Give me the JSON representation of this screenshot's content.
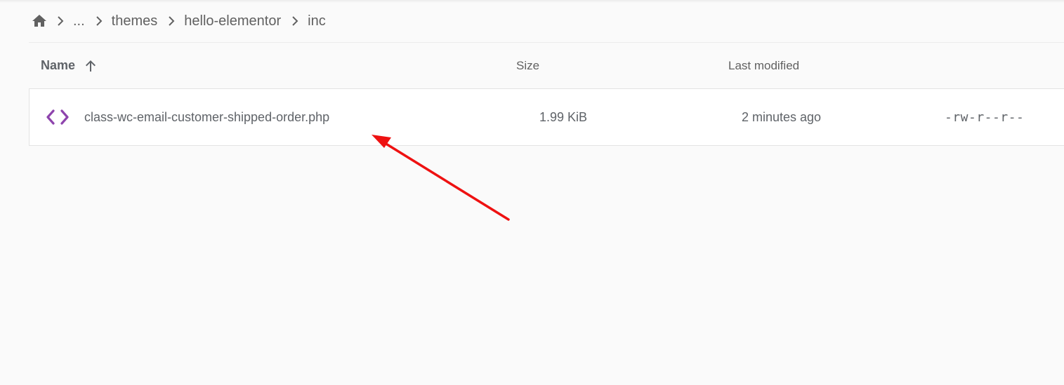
{
  "breadcrumb": {
    "home_icon": "home-icon",
    "separator_icon": "chevron-right-icon",
    "ellipsis": "...",
    "items": [
      "themes",
      "hello-elementor",
      "inc"
    ]
  },
  "table": {
    "headers": {
      "name": "Name",
      "size": "Size",
      "last_modified": "Last modified"
    },
    "sort": {
      "column": "name",
      "direction": "ascending",
      "icon": "arrow-up-icon"
    },
    "rows": [
      {
        "icon": "code-file-icon",
        "name": "class-wc-email-customer-shipped-order.php",
        "size": "1.99 KiB",
        "last_modified": "2 minutes ago",
        "permissions": "-rw-r--r--"
      }
    ]
  },
  "colors": {
    "background": "#fafafa",
    "row_background": "#ffffff",
    "code_icon": "#8e44ad",
    "annotation_arrow": "#ee1111",
    "text": "#5f6368"
  }
}
